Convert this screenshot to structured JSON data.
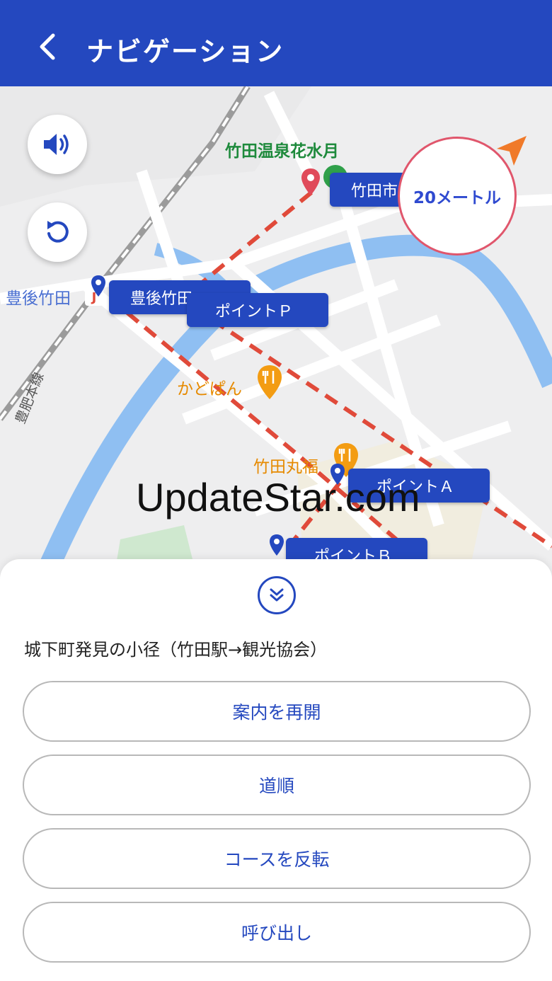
{
  "app_bar": {
    "back_icon": "chevron-left-icon",
    "title": "ナビゲーション",
    "background": "#2448bf"
  },
  "map": {
    "poi_hotel": "竹田温泉花水月",
    "poi_cafe": "かどぱん",
    "poi_restaurant": "竹田丸福",
    "station_label": "豊後竹田",
    "rail_line_label": "豊肥本線",
    "chips": {
      "city_hall": "竹田市役",
      "station": "豊後竹田",
      "point_p": "ポイントＰ",
      "point_a": "ポイントＡ",
      "point_b": "ポイントＢ"
    },
    "distance": "20メートル",
    "sound_icon": "speaker-icon",
    "reset_icon": "rotate-icon",
    "route_color": "#e04a3a",
    "river_color": "#8fbff2"
  },
  "watermark": "UpdateStar.com",
  "sheet": {
    "collapse_icon": "double-chevron-down-icon",
    "route_name": "城下町発見の小径（竹田駅→観光協会）",
    "buttons": {
      "resume": "案内を再開",
      "directions": "道順",
      "reverse": "コースを反転",
      "call": "呼び出し"
    }
  }
}
